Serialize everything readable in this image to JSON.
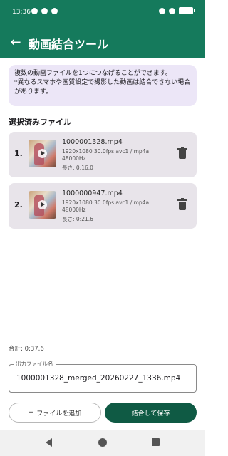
{
  "status_bar": {
    "time": "13:36"
  },
  "app_bar": {
    "back_icon": "arrow-left-icon",
    "title": "動画結合ツール"
  },
  "info": {
    "line1": "複数の動画ファイルを1つにつなげることができます。",
    "line2": "*異なるスマホや画質設定で撮影した動画は結合できない場合があります。"
  },
  "selected_section": {
    "title": "選択済みファイル"
  },
  "files": [
    {
      "index": "1.",
      "name": "1000001328.mp4",
      "spec": "1920x1080 30.0fps avc1 / mp4a",
      "audio": "48000Hz",
      "length": "長さ: 0:16.0"
    },
    {
      "index": "2.",
      "name": "1000000947.mp4",
      "spec": "1920x1080 30.0fps avc1 / mp4a",
      "audio": "48000Hz",
      "length": "長さ: 0:21.6"
    }
  ],
  "total": "合計: 0:37.6",
  "output": {
    "label": "出力ファイル名",
    "value": "1000001328_merged_20260227_1336.mp4"
  },
  "actions": {
    "add_label": "ファイルを追加",
    "add_icon": "plus-icon",
    "merge_label": "結合して保存"
  },
  "colors": {
    "primary": "#157a5c",
    "primary_dark": "#0f5a44",
    "info_bg": "#ece6f7",
    "card_bg": "#e8e4ea"
  }
}
